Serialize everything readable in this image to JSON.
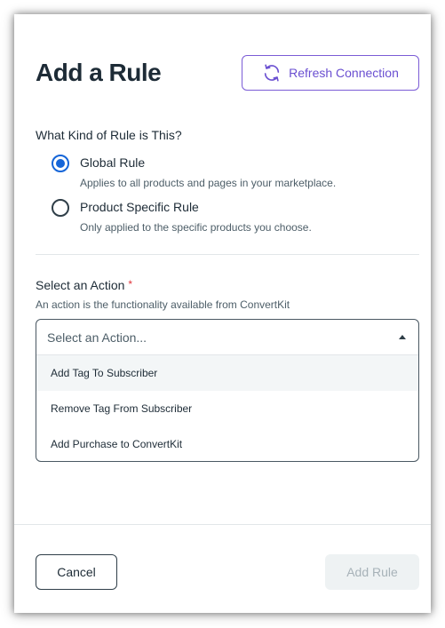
{
  "modal": {
    "title": "Add a Rule",
    "refresh_label": "Refresh Connection"
  },
  "rule_kind": {
    "question": "What Kind of Rule is This?",
    "options": [
      {
        "label": "Global Rule",
        "description": "Applies to all products and pages in your marketplace.",
        "selected": true
      },
      {
        "label": "Product Specific Rule",
        "description": "Only applied to the specific products you choose.",
        "selected": false
      }
    ]
  },
  "action": {
    "label": "Select an Action",
    "required_mark": "*",
    "help": "An action is the functionality available from ConvertKit",
    "placeholder": "Select an Action...",
    "options": [
      "Add Tag To Subscriber",
      "Remove Tag From Subscriber",
      "Add Purchase to ConvertKit"
    ]
  },
  "footer": {
    "cancel_label": "Cancel",
    "add_label": "Add Rule"
  },
  "colors": {
    "accent": "#6a4fd1",
    "radio_selected": "#1565d8",
    "required": "#e0343a",
    "disabled_bg": "#eef2f3"
  },
  "icons": {
    "refresh": "refresh-icon",
    "dropdown": "caret-up-icon"
  }
}
